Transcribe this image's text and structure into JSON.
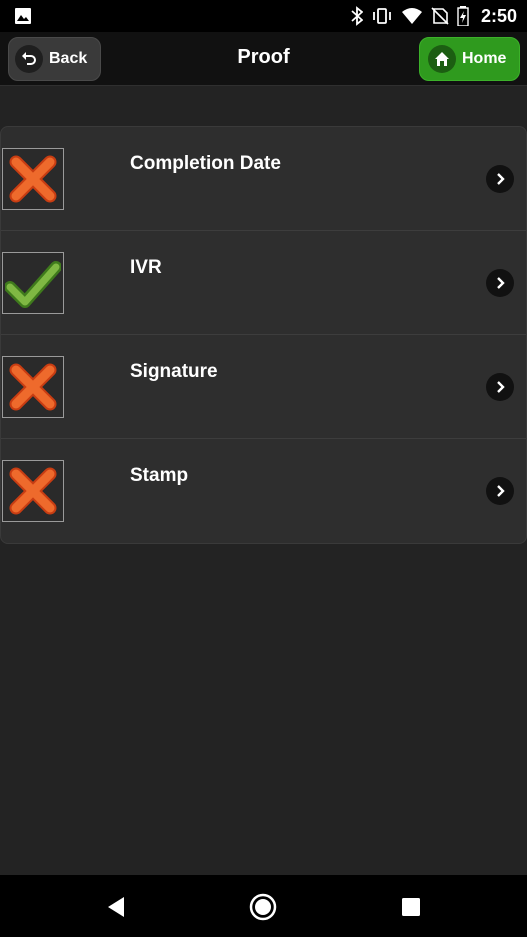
{
  "status_bar": {
    "time": "2:50",
    "icons": [
      "image-icon",
      "bluetooth-icon",
      "vibrate-icon",
      "wifi-icon",
      "no-sim-icon",
      "battery-charging-icon"
    ]
  },
  "header": {
    "title": "Proof",
    "back_label": "Back",
    "home_label": "Home"
  },
  "colors": {
    "home_green": "#2f9a1e",
    "cross_orange": "#e4501c",
    "check_green": "#6aa83a"
  },
  "items": [
    {
      "label": "Completion Date",
      "status": "incomplete",
      "status_icon": "cross-icon"
    },
    {
      "label": "IVR",
      "status": "complete",
      "status_icon": "check-icon"
    },
    {
      "label": "Signature",
      "status": "incomplete",
      "status_icon": "cross-icon"
    },
    {
      "label": "Stamp",
      "status": "incomplete",
      "status_icon": "cross-icon"
    }
  ],
  "nav": {
    "icons": [
      "back-triangle-icon",
      "home-circle-icon",
      "recents-square-icon"
    ]
  }
}
